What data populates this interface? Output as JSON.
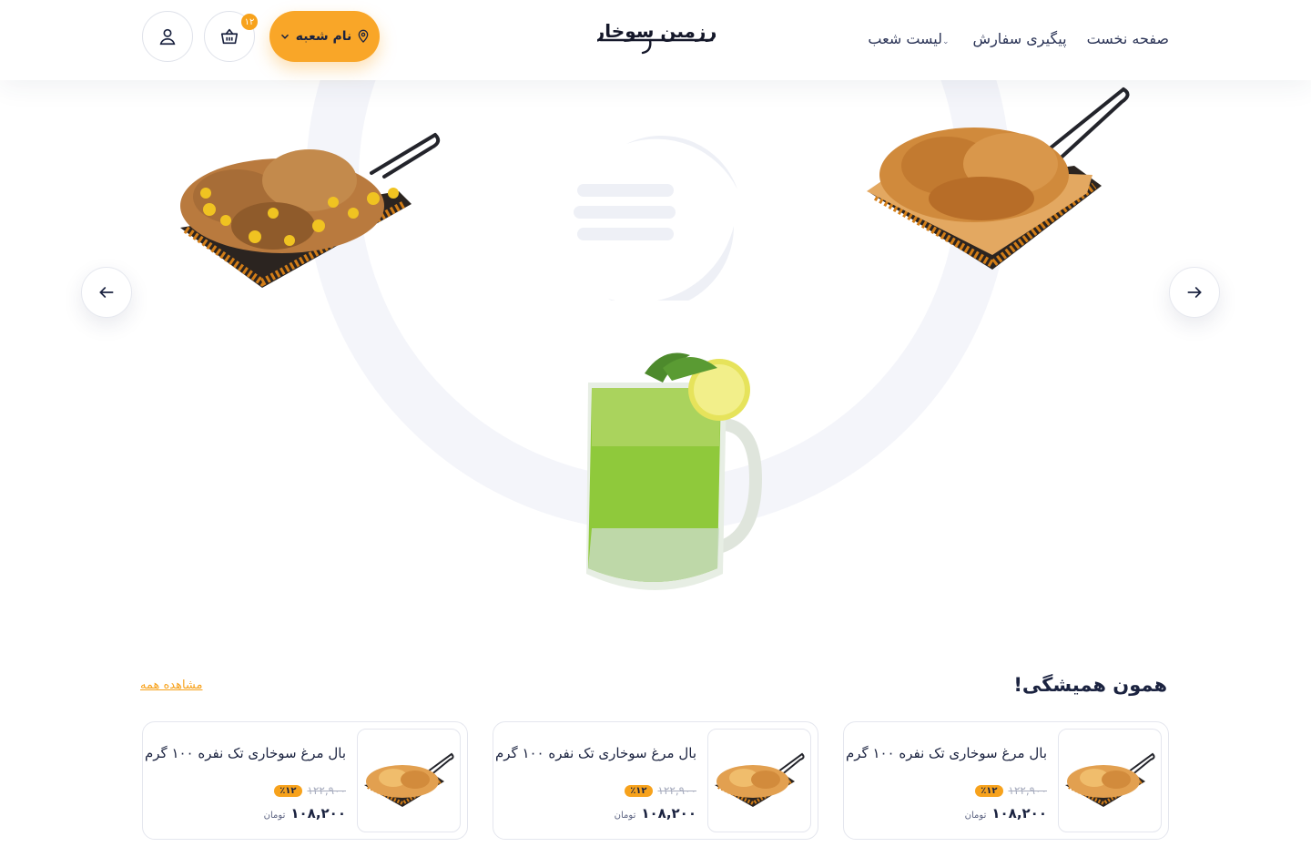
{
  "nav": {
    "home": "صفحه نخست",
    "tracking": "پیگیری سفارش",
    "branches": "لیست شعب"
  },
  "header": {
    "logo_text": "سرزمین سوخاری",
    "branch_button": "نام شعبه",
    "cart_count": "۱۲"
  },
  "hero": {
    "items": [
      "fried-chicken-wings-basket",
      "mojito-mug",
      "chicken-with-corn-basket"
    ]
  },
  "section": {
    "title": "همون همیشگی!",
    "see_all": "مشاهده همه"
  },
  "products": [
    {
      "name": "بال مرغ سوخاری تک نفره ۱۰۰ گرم",
      "old_price": "۱۲۲,۹۰۰",
      "discount": "٪۱۲",
      "price": "۱۰۸,۲۰۰",
      "unit": "تومان"
    },
    {
      "name": "بال مرغ سوخاری تک نفره ۱۰۰ گرم",
      "old_price": "۱۲۲,۹۰۰",
      "discount": "٪۱۲",
      "price": "۱۰۸,۲۰۰",
      "unit": "تومان"
    },
    {
      "name": "بال مرغ سوخاری تک نفره ۱۰۰ گرم",
      "old_price": "۱۲۲,۹۰۰",
      "discount": "٪۱۲",
      "price": "۱۰۸,۲۰۰",
      "unit": "تومان"
    }
  ],
  "colors": {
    "accent": "#f9a628",
    "text": "#1b2340",
    "ring": "#f4f5fa"
  }
}
